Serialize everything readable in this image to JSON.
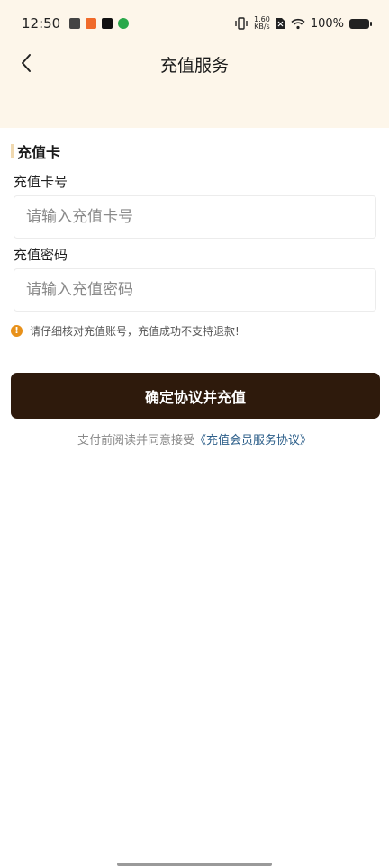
{
  "status_bar": {
    "time": "12:50",
    "net_speed_value": "1.60",
    "net_speed_unit": "KB/s",
    "battery": "100%",
    "icons": [
      "clipboard-check-icon",
      "app-orange-icon",
      "tiktok-icon",
      "app-green-icon",
      "vibrate-icon",
      "sim-off-icon",
      "wifi-icon",
      "battery-icon"
    ]
  },
  "nav": {
    "back_icon": "chevron-left-icon",
    "title": "充值服务"
  },
  "section": {
    "title": "充值卡"
  },
  "fields": {
    "card_number": {
      "label": "充值卡号",
      "placeholder": "请输入充值卡号",
      "value": ""
    },
    "card_password": {
      "label": "充值密码",
      "placeholder": "请输入充值密码",
      "value": ""
    }
  },
  "warning": {
    "icon": "exclamation-circle-icon",
    "text": "请仔细核对充值账号，充值成功不支持退款!"
  },
  "confirm_button": {
    "label": "确定协议并充值"
  },
  "agreement": {
    "prefix": "支付前阅读并同意接受",
    "link": "《充值会员服务协议》"
  },
  "colors": {
    "header_bg": "#fdf6ea",
    "button_bg": "#2e1a0c",
    "link": "#2d5f8a",
    "warning": "#e8911a"
  }
}
